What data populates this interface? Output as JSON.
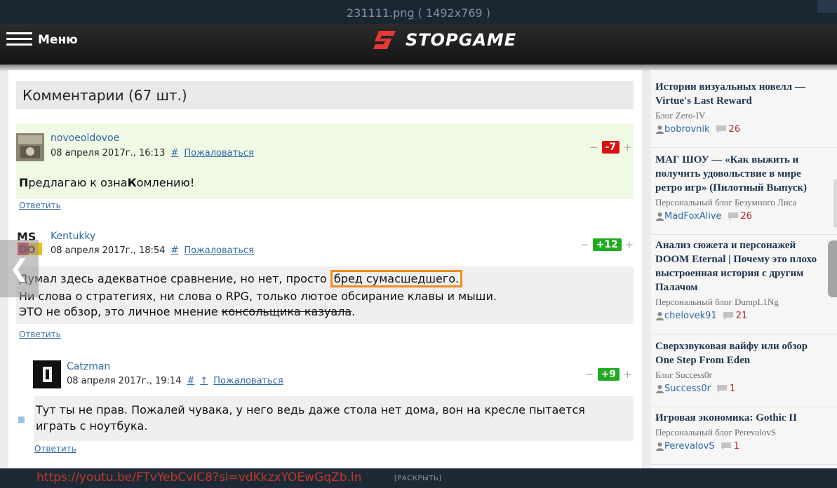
{
  "viewer": {
    "title": "231111.png ( 1492x769 )"
  },
  "site": {
    "menu_label": "Меню",
    "logo_text": "STOPGAME",
    "accent_color": "#e53935"
  },
  "comments": {
    "header": "Комментарии (67 шт.)",
    "items": [
      {
        "author": "novoeoldovoe",
        "date": "08 апреля 2017г., 16:13",
        "hash": "#",
        "complain": "Пожаловаться",
        "score": "-7",
        "score_color": "#dd1111",
        "text_parts": [
          "П",
          "редлагаю к озна",
          "К",
          "омлению!"
        ],
        "reply": "Ответить"
      },
      {
        "author": "Kentukky",
        "date": "08 апреля 2017г., 18:54",
        "hash": "#",
        "complain": "Пожаловаться",
        "score": "+12",
        "score_color": "#22aa22",
        "line1_pre": "Думал здесь адекватное сравнение, но нет, просто",
        "line1_highlight": "бред сумасшедшего.",
        "line2": "Ни слова о стратегиях, ни слова о RPG, только лютое обсирание клавы и мыши.",
        "line3_pre": "ЭТО не обзор, это личное мнение",
        "line3_strike": "консольщика казуала",
        "line3_post": ".",
        "reply": "Ответить"
      },
      {
        "author": "Catzman",
        "date": "08 апреля 2017г., 19:14",
        "hash": "#",
        "up": "↑",
        "complain": "Пожаловаться",
        "score": "+9",
        "score_color": "#22aa22",
        "line1": "Тут ты не прав. Пожалей чувака, у него ведь даже стола нет дома, вон на кресле пытается",
        "line2": "играть с ноутбука.",
        "reply": "Ответить"
      }
    ],
    "vote_minus": "−",
    "vote_plus": "+"
  },
  "sidebar": {
    "items": [
      {
        "title_lines": [
          "Истории визуальных новелл —",
          "Virtue's Last Reward"
        ],
        "blog": "Блог Zero-IV",
        "user": "bobrovnik",
        "count": "26"
      },
      {
        "title_lines": [
          "МАГ ШОУ — «Как выжить и",
          "получить удовольствие в мире",
          "ретро игр» (Пилотный Выпуск)"
        ],
        "blog": "Персональный блог Безумного Лиса",
        "user": "MadFoxAlive",
        "count": "26"
      },
      {
        "title_lines": [
          "Анализ сюжета и персонажей",
          "DOOM Eternal | Почему это плохо",
          "выстроенная история с другим",
          "Палачом"
        ],
        "blog": "Персональный блог DumpL1Ng",
        "user": "chelovek91",
        "count": "21"
      },
      {
        "title_lines": [
          "Сверхзвуковая вайфу или обзор",
          "One Step From Eden"
        ],
        "blog": "Блог Success0r",
        "user": "Success0r",
        "count": "1"
      },
      {
        "title_lines": [
          "Игровая экономика: Gothic II"
        ],
        "blog": "Персональный блог PerevalovS",
        "user": "PerevalovS",
        "count": "1"
      }
    ]
  },
  "bottom": {
    "link_text": "https://youtu.be/FTvYebCvIC8?si=vdKkzxYOEwGqZb.ln",
    "expand_label": "[РАСКРЫТЬ]"
  }
}
